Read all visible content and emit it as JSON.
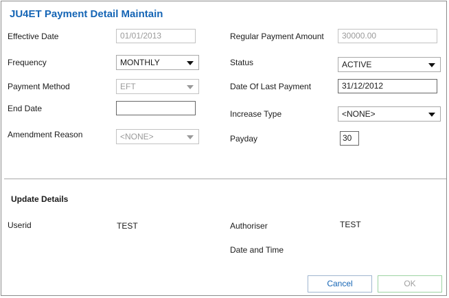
{
  "title": "JU4ET Payment Detail Maintain",
  "fields": {
    "effective_date": {
      "label": "Effective Date",
      "value": "01/01/2013"
    },
    "frequency": {
      "label": "Frequency",
      "value": "MONTHLY"
    },
    "payment_method": {
      "label": "Payment Method",
      "value": "EFT"
    },
    "end_date": {
      "label": "End Date",
      "value": ""
    },
    "amendment_reason": {
      "label": "Amendment Reason",
      "value": "<NONE>"
    },
    "regular_payment_amount": {
      "label": "Regular Payment Amount",
      "value": "30000.00"
    },
    "status": {
      "label": "Status",
      "value": "ACTIVE"
    },
    "date_of_last_payment": {
      "label": "Date Of Last Payment",
      "value": "31/12/2012"
    },
    "increase_type": {
      "label": "Increase Type",
      "value": "<NONE>"
    },
    "payday": {
      "label": "Payday",
      "value": "30"
    }
  },
  "update_details": {
    "heading": "Update Details",
    "userid": {
      "label": "Userid",
      "value": "TEST"
    },
    "authoriser": {
      "label": "Authoriser",
      "value": "TEST"
    },
    "date_and_time": {
      "label": "Date and Time",
      "value": ""
    }
  },
  "buttons": {
    "cancel": "Cancel",
    "ok": "OK"
  }
}
